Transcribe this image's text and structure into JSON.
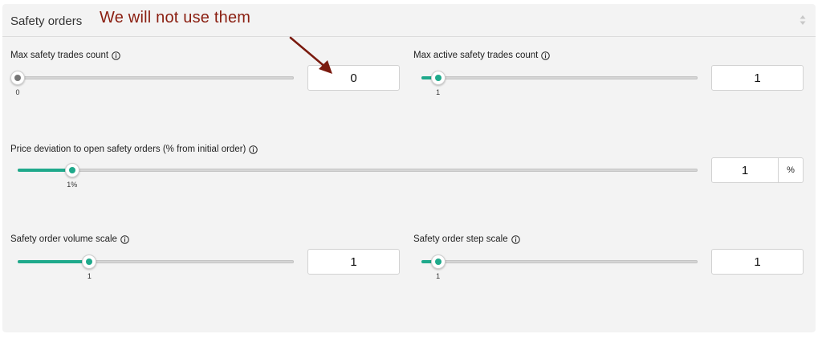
{
  "panel": {
    "title": "Safety orders",
    "annotation": "We will not use them"
  },
  "fields": {
    "max_safety_trades": {
      "label": "Max safety trades count",
      "value": "0",
      "slider_fraction": 0.0,
      "tick": "0"
    },
    "max_active_safety_trades": {
      "label": "Max active safety trades count",
      "value": "1",
      "slider_fraction": 0.06,
      "tick": "1"
    },
    "price_deviation": {
      "label": "Price deviation to open safety orders (% from initial order)",
      "value": "1",
      "unit": "%",
      "slider_fraction": 0.08,
      "tick": "1%"
    },
    "volume_scale": {
      "label": "Safety order volume scale",
      "value": "1",
      "slider_fraction": 0.26,
      "tick": "1"
    },
    "step_scale": {
      "label": "Safety order step scale",
      "value": "1",
      "slider_fraction": 0.06,
      "tick": "1"
    }
  },
  "colors": {
    "accent": "#1fa98b",
    "annotation": "#8a1e10",
    "disabled_dot": "#777777"
  },
  "icons": {
    "info": "info-icon",
    "sort": "sort-icon",
    "arrow": "annotation-arrow-icon"
  }
}
